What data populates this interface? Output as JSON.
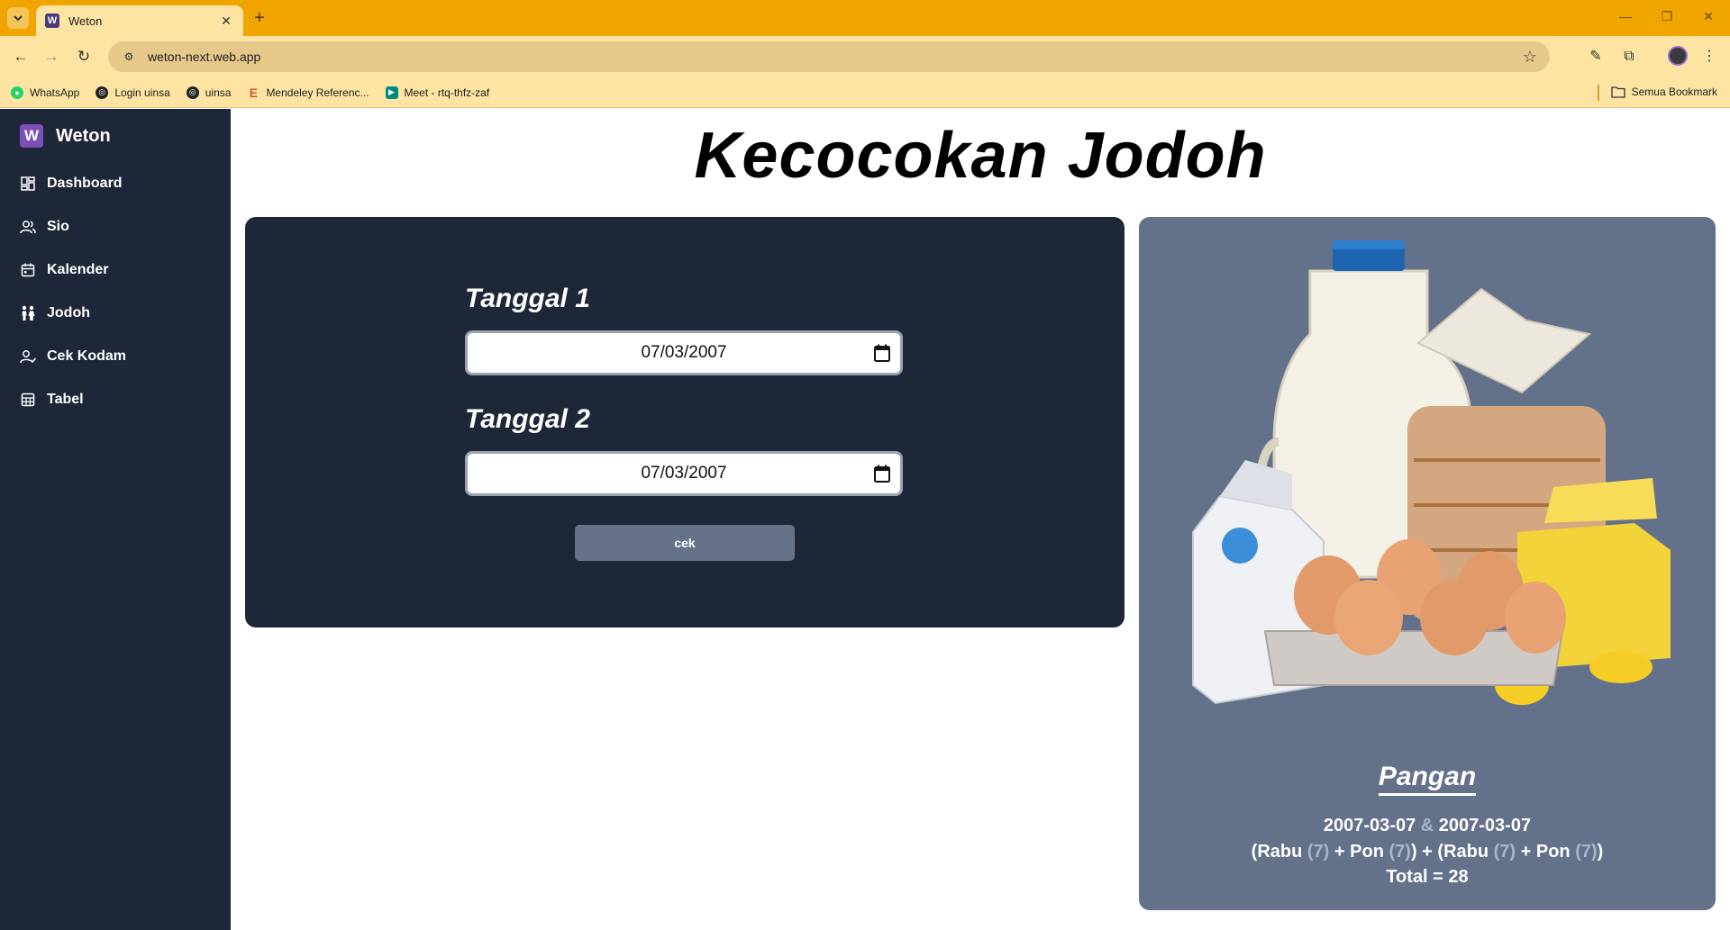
{
  "browser": {
    "tab_title": "Weton",
    "url": "weton-next.web.app",
    "bookmarks": [
      "WhatsApp",
      "Login uinsa",
      "uinsa",
      "Mendeley Referenc...",
      "Meet - rtq-thfz-zaf"
    ],
    "bookmarks_folder": "Semua Bookmark"
  },
  "sidebar": {
    "brand": "Weton",
    "logo_letter": "W",
    "items": [
      {
        "label": "Dashboard",
        "icon": "dashboard-icon"
      },
      {
        "label": "Sio",
        "icon": "users-icon"
      },
      {
        "label": "Kalender",
        "icon": "calendar-icon"
      },
      {
        "label": "Jodoh",
        "icon": "couple-icon"
      },
      {
        "label": "Cek Kodam",
        "icon": "user-check-icon"
      },
      {
        "label": "Tabel",
        "icon": "table-icon"
      }
    ]
  },
  "page": {
    "title": "Kecocokan Jodoh"
  },
  "form": {
    "date1_label": "Tanggal 1",
    "date1_value": "07/03/2007",
    "date2_label": "Tanggal 2",
    "date2_value": "07/03/2007",
    "submit_label": "cek"
  },
  "result": {
    "title": "Pangan",
    "date_a": "2007-03-07",
    "amp": "&",
    "date_b": "2007-03-07",
    "day1": "Rabu",
    "day1_val": "(7)",
    "pasaran1": "Pon",
    "pasaran1_val": "(7)",
    "day2": "Rabu",
    "day2_val": "(7)",
    "pasaran2": "Pon",
    "pasaran2_val": "(7)",
    "total": "Total = 28"
  },
  "colors": {
    "sidebar_bg": "#1e2738",
    "result_bg": "#63718b",
    "button_bg": "#657289",
    "chrome_accent": "#f0a500"
  }
}
